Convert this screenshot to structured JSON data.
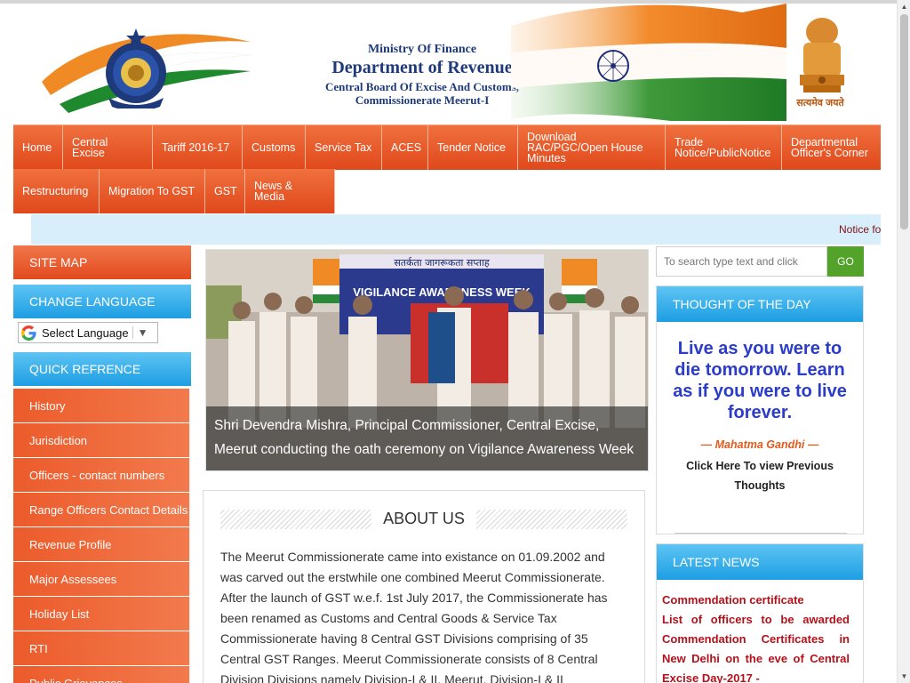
{
  "header": {
    "ministry": "Ministry Of Finance",
    "department": "Department of Revenue",
    "board": "Central Board Of Excise And Customs,",
    "commissionerate": "Commissionerate Meerut-I",
    "motto": "सत्यमेव जयते",
    "left_logo_icon": "cbec-emblem-icon",
    "right_logo_icon": "ashoka-emblem-icon"
  },
  "nav": {
    "row1": [
      {
        "label": "Home"
      },
      {
        "label": "Central Excise"
      },
      {
        "label": "Tariff 2016-17"
      },
      {
        "label": "Customs"
      },
      {
        "label": "Service Tax"
      },
      {
        "label": "ACES"
      },
      {
        "label": "Tender Notice"
      },
      {
        "label": "Download RAC/PGC/Open House Minutes"
      },
      {
        "label": "Trade Notice/PublicNotice"
      },
      {
        "label": "Departmental Officer's Corner"
      }
    ],
    "row2": [
      {
        "label": "Restructuring"
      },
      {
        "label": "Migration To GST"
      },
      {
        "label": "GST"
      },
      {
        "label": "News & Media"
      }
    ]
  },
  "notice": {
    "text": "Notice fo"
  },
  "sidebar": {
    "site_map": "SITE MAP",
    "change_language": "CHANGE LANGUAGE",
    "language_select": "Select Language",
    "quick_reference": "QUICK REFRENCE",
    "items": [
      {
        "label": "History"
      },
      {
        "label": "Jurisdiction"
      },
      {
        "label": "Officers - contact numbers"
      },
      {
        "label": "Range Officers Contact Details"
      },
      {
        "label": "Revenue Profile"
      },
      {
        "label": "Major Assessees"
      },
      {
        "label": "Holiday List"
      },
      {
        "label": "RTI"
      },
      {
        "label": "Public Grievances"
      }
    ]
  },
  "slider": {
    "caption": "Shri Devendra Mishra, Principal Commissioner, Central Excise, Meerut conducting the oath ceremony on Vigilance Awareness Week",
    "banner_hindi": "सतर्कता जागरूकता सप्ताह",
    "banner_english": "VIGILANCE AWARENESS WEEK"
  },
  "about": {
    "title": "ABOUT US",
    "text": "The Meerut Commissionerate came into existance on 01.09.2002 and was carved out the erstwhile one combined Meerut Commissionerate. After the launch of GST w.e.f. 1st July 2017, the Commissionerate has been renamed as Customs and Central Goods & Service Tax  Commissionerate having 8 Central GST Divisions comprising of 35 Central GST Ranges. Meerut Commissionerate consists of 8 Central Division Divisions namely Division-I & II, Meerut, Division-I & II"
  },
  "search": {
    "placeholder": "To search type text and click",
    "button": "GO"
  },
  "thought": {
    "title": "THOUGHT OF THE DAY",
    "quote": "Live as you were to die tomorrow. Learn as if you were to live forever.",
    "author": "— Mahatma Gandhi —",
    "link": "Click Here To view Previous Thoughts"
  },
  "news": {
    "title": "LATEST NEWS",
    "item_title": "Commendation certificate",
    "item_desc": "List of officers to be awarded Commendation Certificates in New Delhi on the eve of Central Excise Day-2017 -"
  },
  "colors": {
    "nav_orange": "#e8572a",
    "sidebar_blue": "#1d9ee3",
    "search_green": "#53a229",
    "quote_blue": "#2a3cc9",
    "news_red": "#b4111b"
  }
}
